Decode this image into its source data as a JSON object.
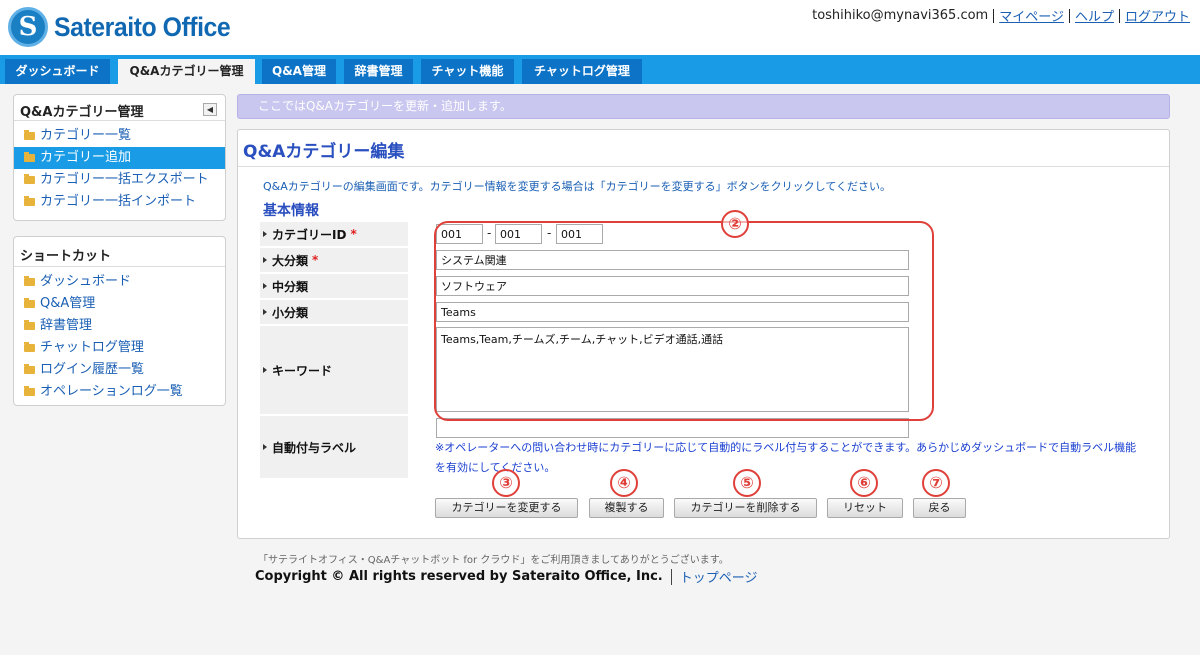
{
  "header": {
    "logo_text": "Sateraito Office",
    "logo_mark": "S",
    "user_email": "toshihiko@mynavi365.com",
    "links": [
      "マイページ",
      "ヘルプ",
      "ログアウト"
    ]
  },
  "tabs": [
    "ダッシュボード",
    "Q&Aカテゴリー管理",
    "Q&A管理",
    "辞書管理",
    "チャット機能",
    "チャットログ管理"
  ],
  "active_tab_index": 1,
  "sidebar": {
    "section1": {
      "title": "Q&Aカテゴリー管理",
      "items": [
        "カテゴリー一覧",
        "カテゴリー追加",
        "カテゴリー一括エクスポート",
        "カテゴリー一括インポート"
      ],
      "active_index": 1
    },
    "section2": {
      "title": "ショートカット",
      "items": [
        "ダッシュボード",
        "Q&A管理",
        "辞書管理",
        "チャットログ管理",
        "ログイン履歴一覧",
        "オペレーションログ一覧"
      ]
    }
  },
  "infobar": "ここではQ&Aカテゴリーを更新・追加します。",
  "panel": {
    "title": "Q&Aカテゴリー編集",
    "description": "Q&Aカテゴリーの編集画面です。カテゴリー情報を変更する場合は「カテゴリーを変更する」ボタンをクリックしてください。",
    "section_title": "基本情報"
  },
  "form": {
    "category_id_label": "カテゴリーID",
    "category_id": [
      "001",
      "001",
      "001"
    ],
    "id_separator": "-",
    "required_mark": "*",
    "major_label": "大分類",
    "major_value": "システム関連",
    "middle_label": "中分類",
    "middle_value": "ソフトウェア",
    "minor_label": "小分類",
    "minor_value": "Teams",
    "keyword_label": "キーワード",
    "keyword_value": "Teams,Team,チームズ,チーム,チャット,ビデオ通話,通話",
    "auto_label_label": "自動付与ラベル",
    "auto_label_value": "",
    "auto_label_note": "※オペレーターへの問い合わせ時にカテゴリーに応じて自動的にラベル付与することができます。あらかじめダッシュボードで自動ラベル機能を有効にしてください。"
  },
  "buttons": {
    "change": "カテゴリーを変更する",
    "duplicate": "複製する",
    "delete": "カテゴリーを削除する",
    "reset": "リセット",
    "back": "戻る"
  },
  "annotations": [
    "②",
    "③",
    "④",
    "⑤",
    "⑥",
    "⑦"
  ],
  "footer": {
    "thanks": "「サテライトオフィス・Q&Aチャットボット for クラウド」をご利用頂きましてありがとうございます。",
    "copyright": "Copyright © All rights reserved by Sateraito Office, Inc.",
    "top_link": "トップページ"
  },
  "colors": {
    "tabbar": "#1a9be6",
    "tab": "#0d73c7",
    "accent": "#2a4fbf",
    "annotation": "#e0403a",
    "infobar": "#c9c6ef"
  }
}
